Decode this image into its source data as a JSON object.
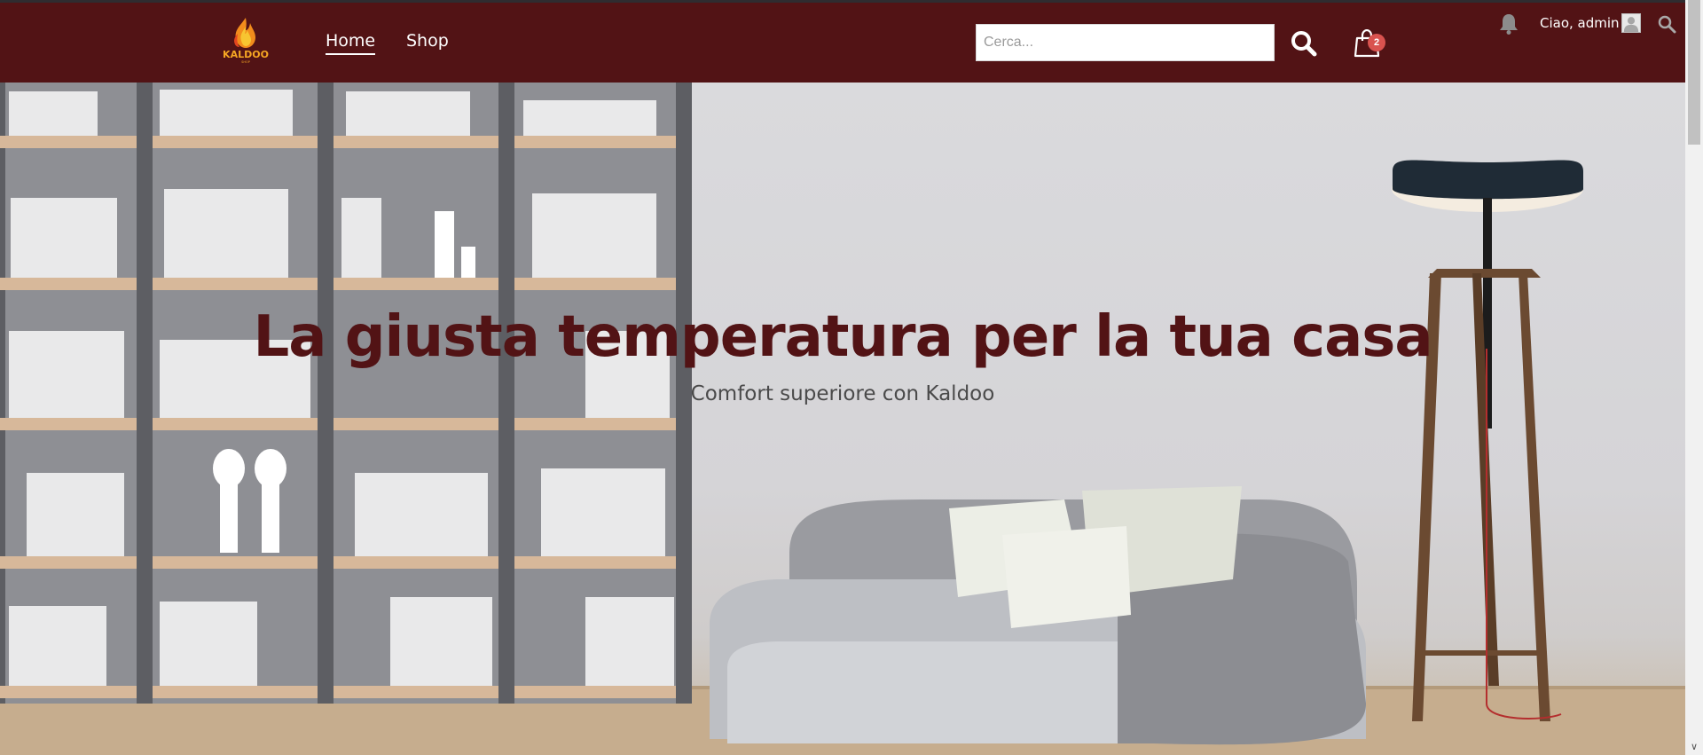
{
  "header": {
    "logo_text": "KALDOO",
    "nav": [
      {
        "label": "Home",
        "active": true
      },
      {
        "label": "Shop",
        "active": false
      }
    ],
    "search": {
      "placeholder": "Cerca..."
    },
    "cart": {
      "count": "2"
    },
    "greeting": "Ciao, admin",
    "background": "#521315"
  },
  "icons": {
    "logo": "flame-logo-icon",
    "search": "search-icon",
    "cart": "shopping-bag-icon",
    "bell": "bell-icon",
    "avatar": "user-avatar-icon",
    "top_search": "search-icon",
    "scroll_down": "chevron-down-icon"
  },
  "hero": {
    "title": "La giusta temperatura per la tua casa",
    "subtitle": "Comfort superiore con Kaldoo",
    "title_color": "#521315"
  },
  "colors": {
    "brand": "#521315",
    "badge": "#d9534f"
  }
}
